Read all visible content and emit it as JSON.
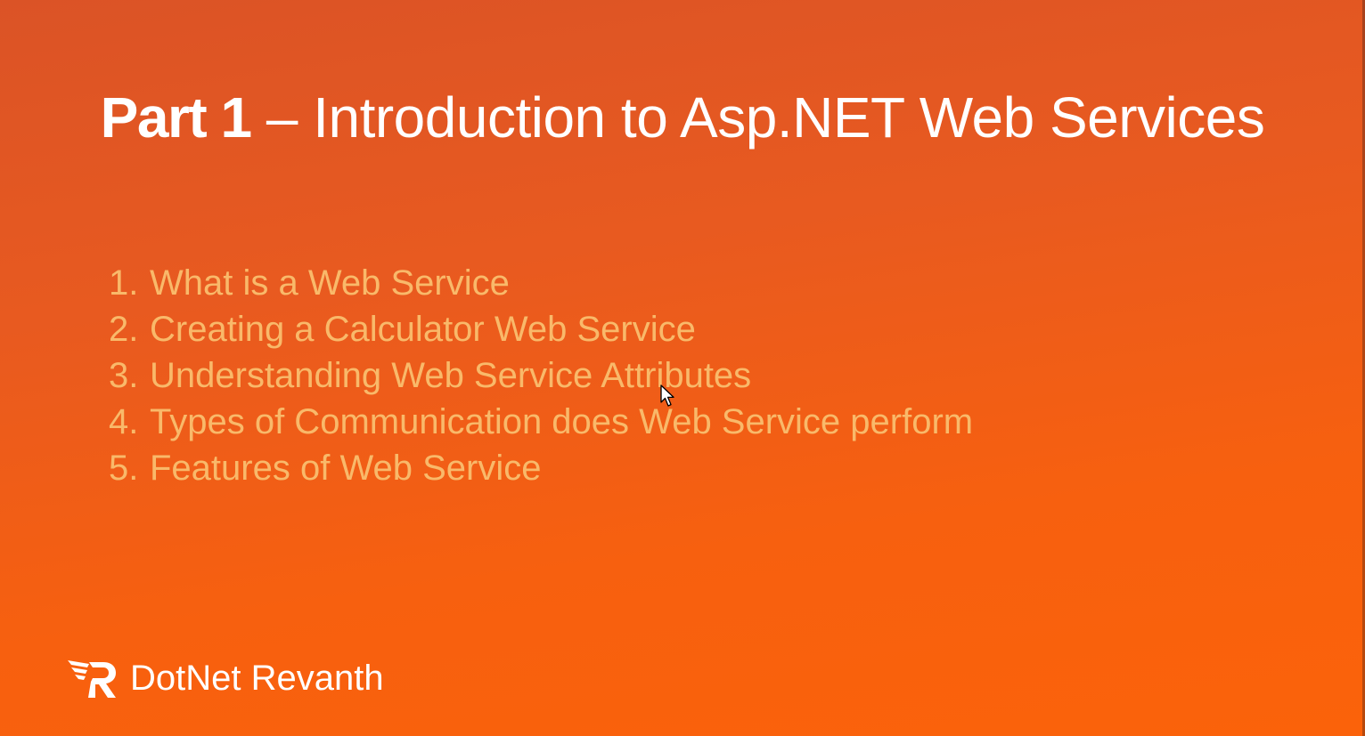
{
  "slide": {
    "title_part": "Part 1",
    "title_rest": " – Introduction to Asp.NET Web Services",
    "topics": [
      {
        "number": "1.",
        "text": "What is a Web Service"
      },
      {
        "number": "2.",
        "text": "Creating a Calculator Web Service"
      },
      {
        "number": "3.",
        "text": "Understanding Web Service Attributes"
      },
      {
        "number": "4.",
        "text": "Types of Communication does Web Service perform"
      },
      {
        "number": "5.",
        "text": "Features of Web Service"
      }
    ]
  },
  "brand": {
    "name": "DotNet Revanth",
    "logo_icon": "winged-r-logo-icon"
  },
  "colors": {
    "background_top": "#db5326",
    "background_bottom": "#fb620a",
    "title": "#ffffff",
    "topic_text": "#f9b96a"
  }
}
